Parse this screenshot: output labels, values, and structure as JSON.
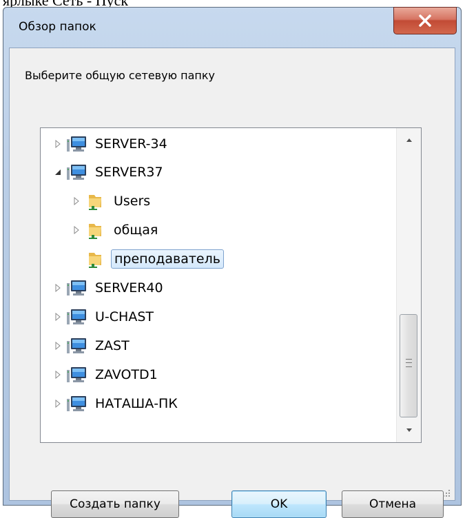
{
  "background_text": "ярлыке Сеть - Пуск",
  "dialog": {
    "title": "Обзор папок",
    "prompt": "Выберите общую сетевую папку",
    "tree": [
      {
        "label": "SERVER-34",
        "type": "computer",
        "arrow": "collapsed"
      },
      {
        "label": "SERVER37",
        "type": "computer",
        "arrow": "expanded"
      },
      {
        "label": "Users",
        "type": "folder",
        "arrow": "collapsed"
      },
      {
        "label": "общая",
        "type": "folder",
        "arrow": "collapsed"
      },
      {
        "label": "преподаватель",
        "type": "folder",
        "arrow": "none",
        "selected": true
      },
      {
        "label": "SERVER40",
        "type": "computer",
        "arrow": "collapsed"
      },
      {
        "label": "U-CHAST",
        "type": "computer",
        "arrow": "collapsed"
      },
      {
        "label": "ZAST",
        "type": "computer",
        "arrow": "collapsed"
      },
      {
        "label": "ZAVOTD1",
        "type": "computer",
        "arrow": "collapsed"
      },
      {
        "label": "НАТАША-ПК",
        "type": "computer",
        "arrow": "collapsed"
      }
    ],
    "buttons": {
      "create_folder": "Создать папку",
      "ok": "OK",
      "cancel": "Отмена"
    }
  },
  "colors": {
    "close_button": "#c24b35",
    "selection_border": "#7da2ce",
    "default_button_border": "#3c7fb1"
  }
}
